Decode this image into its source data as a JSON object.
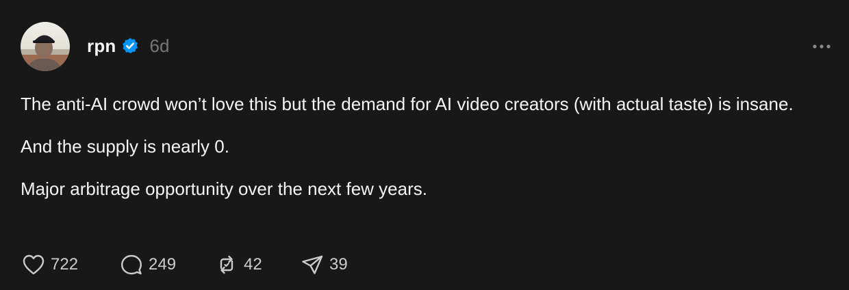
{
  "post": {
    "author": {
      "username": "rpn",
      "verified": true,
      "avatar_icon": "avatar-photo"
    },
    "timestamp": "6d",
    "more_icon": "more-horizontal-icon",
    "body": [
      "The anti-AI crowd won’t love this but the demand for AI video creators (with actual taste) is insane.",
      "And the supply is nearly 0.",
      "Major arbitrage opportunity over the next few years."
    ],
    "actions": {
      "likes": "722",
      "replies": "249",
      "reposts": "42",
      "shares": "39"
    }
  },
  "colors": {
    "background": "#181818",
    "text": "#f3f5f7",
    "muted": "#777777",
    "verified": "#0095f6"
  }
}
